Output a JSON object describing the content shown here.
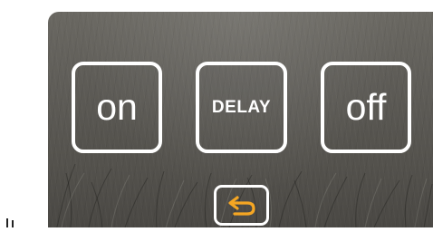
{
  "buttons": {
    "on_label": "on",
    "delay_label": "DELAY",
    "off_label": "off"
  },
  "back_button": {
    "icon": "return-arrow-icon"
  },
  "colors": {
    "button_border": "#ffffff",
    "button_text": "#ffffff",
    "back_icon": "#f5a623",
    "background": "#5f5d58"
  }
}
